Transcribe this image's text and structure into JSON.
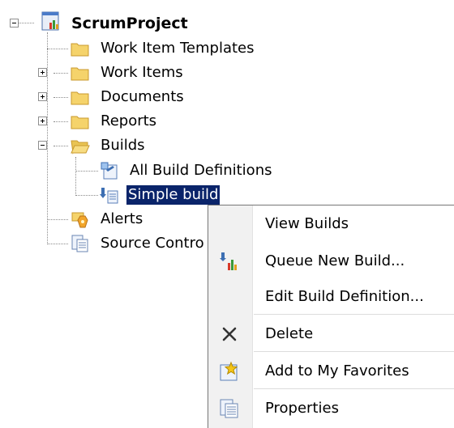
{
  "tree": {
    "root": {
      "label": "ScrumProject",
      "icon": "team-project-icon",
      "expander": "collapse"
    },
    "items": [
      {
        "label": "Work Item Templates",
        "icon": "folder-icon",
        "expander": "none"
      },
      {
        "label": "Work Items",
        "icon": "folder-icon",
        "expander": "expand"
      },
      {
        "label": "Documents",
        "icon": "folder-icon",
        "expander": "expand"
      },
      {
        "label": "Reports",
        "icon": "folder-icon",
        "expander": "expand"
      },
      {
        "label": "Builds",
        "icon": "folder-open-icon",
        "expander": "collapse"
      },
      {
        "label": "Alerts",
        "icon": "alerts-icon",
        "expander": "none"
      },
      {
        "label": "Source Contro",
        "icon": "source-control-icon",
        "expander": "none"
      }
    ],
    "builds_children": [
      {
        "label": "All Build Definitions",
        "icon": "build-definitions-icon"
      },
      {
        "label": "Simple build",
        "icon": "build-definition-icon",
        "selected": true
      }
    ]
  },
  "context_menu": {
    "items": [
      {
        "label": "View Builds",
        "icon": ""
      },
      {
        "label": "Queue New Build...",
        "icon": "queue-build-icon"
      },
      {
        "label": "Edit Build Definition...",
        "icon": ""
      },
      {
        "label": "Delete",
        "icon": "delete-x-icon"
      },
      {
        "label": "Add to My Favorites",
        "icon": "add-favorites-icon"
      },
      {
        "label": "Properties",
        "icon": "properties-icon"
      }
    ]
  },
  "colors": {
    "selection": "#0a246a",
    "folder": "#f5d36b",
    "menu_gutter": "#f1f1f1"
  }
}
